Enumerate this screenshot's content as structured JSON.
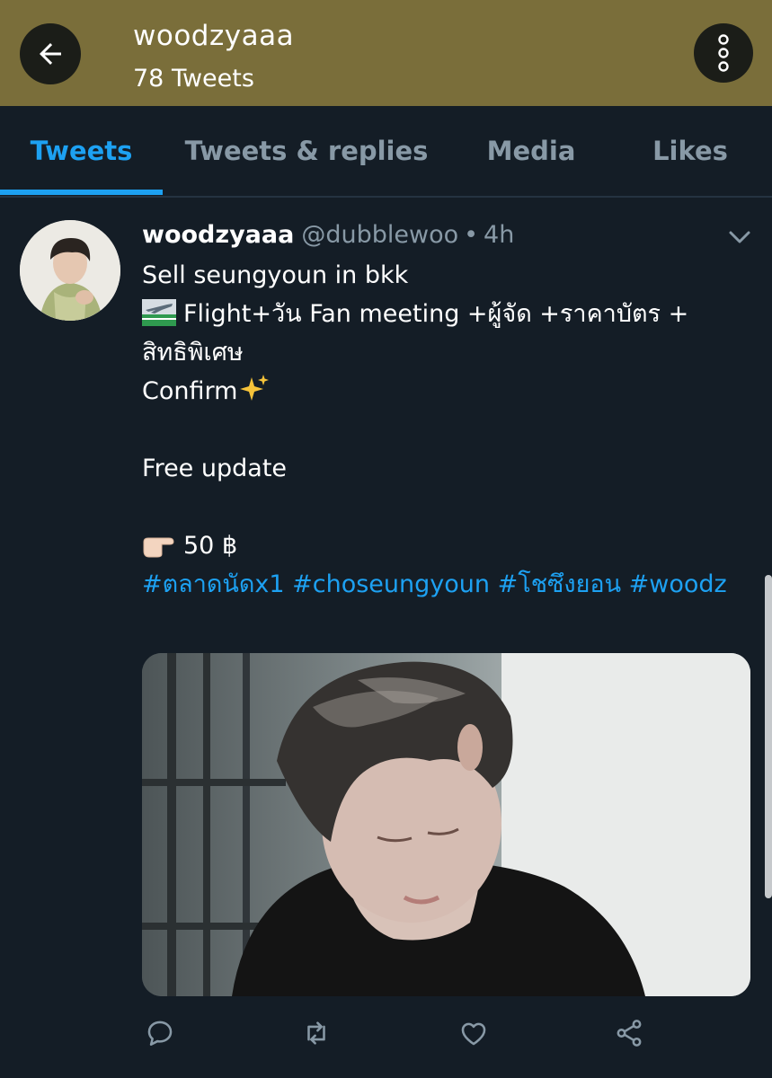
{
  "header": {
    "name": "woodzyaaa",
    "tweet_count": "78 Tweets",
    "back_icon": "arrow-left-icon",
    "more_icon": "vertical-dots-icon"
  },
  "tabs": [
    "Tweets",
    "Tweets & replies",
    "Media",
    "Likes"
  ],
  "active_tab": "Tweets",
  "tweet": {
    "display_name": "woodzyaaa",
    "handle": "@dubblewoo",
    "separator": "•",
    "time": "4h",
    "lines": {
      "l1": "Sell seungyoun in bkk",
      "l2": "Flight+วัน Fan meeting  +ผู้จัด +ราคาบัตร +",
      "l3": "สิทธิพิเศษ",
      "l4": "Confirm",
      "l6": "Free update",
      "l8": "50 ฿"
    },
    "hashtags": [
      "#ตลาดนัดx1",
      "#choseungyoun",
      "#โชซึงยอน",
      "#woodz"
    ],
    "emoji": {
      "airplane": "airplane-departure-icon",
      "sparkles": "sparkles-icon",
      "pointing": "pointing-hand-icon"
    }
  },
  "actions": [
    "reply-icon",
    "retweet-icon",
    "like-icon",
    "share-icon"
  ],
  "colors": {
    "header_bg": "#7a6e3a",
    "page_bg": "#141d26",
    "accent": "#1da1f2",
    "muted": "#8899a6"
  }
}
